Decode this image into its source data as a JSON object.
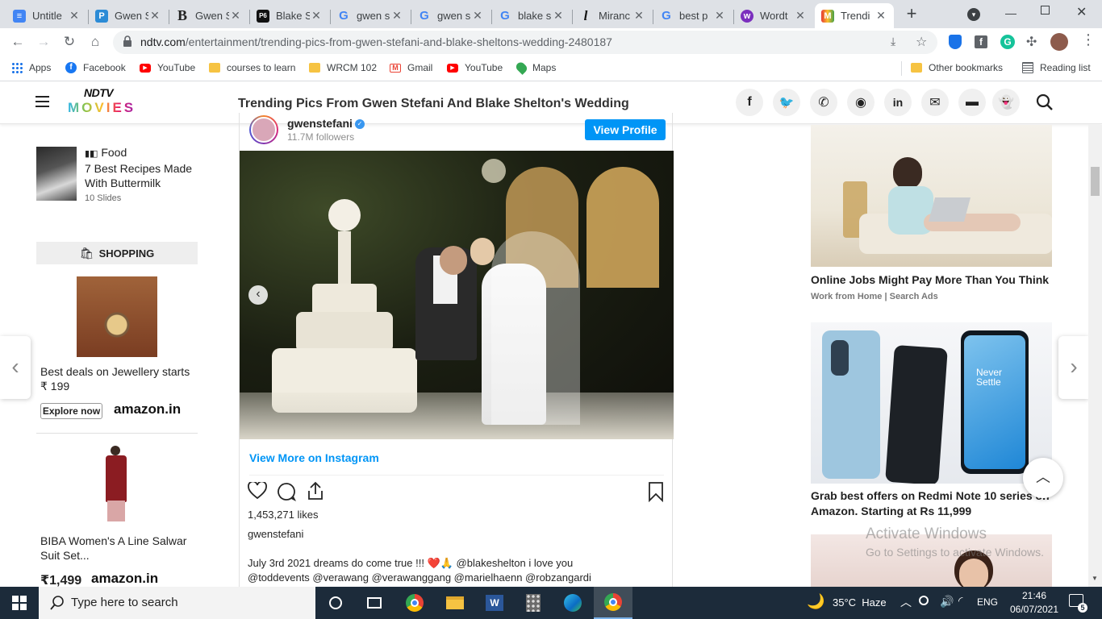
{
  "tabs": [
    {
      "title": "Untitle",
      "icon": "docs-icon",
      "color": "#4285f4",
      "glyph": "≡"
    },
    {
      "title": "Gwen S",
      "icon": "pinkvilla-icon",
      "color": "#2b8bd6",
      "glyph": "P"
    },
    {
      "title": "Gwen S",
      "icon": "b-icon",
      "color": "#ffffff",
      "glyph": "B"
    },
    {
      "title": "Blake S",
      "icon": "pagesix-icon",
      "color": "#111111",
      "glyph": "6"
    },
    {
      "title": "gwen s",
      "icon": "google-icon",
      "color": "#ffffff",
      "glyph": "G"
    },
    {
      "title": "gwen s",
      "icon": "google-icon",
      "color": "#ffffff",
      "glyph": "G"
    },
    {
      "title": "blake s",
      "icon": "google-icon",
      "color": "#ffffff",
      "glyph": "G"
    },
    {
      "title": "Miranc",
      "icon": "l-icon",
      "color": "#ffffff",
      "glyph": "l"
    },
    {
      "title": "best p",
      "icon": "google-icon",
      "color": "#ffffff",
      "glyph": "G"
    },
    {
      "title": "Wordt",
      "icon": "wordtune-icon",
      "color": "#7b2fbe",
      "glyph": "w"
    },
    {
      "title": "Trendi",
      "icon": "ndtv-icon",
      "color": "#ffffff",
      "glyph": "M"
    }
  ],
  "toolbar": {
    "url_domain": "ndtv.com",
    "url_path": "/entertainment/trending-pics-from-gwen-stefani-and-blake-sheltons-wedding-2480187"
  },
  "bookmarks": {
    "items": [
      {
        "label": "Apps",
        "icon": "apps-grid-icon",
        "color": "#1a73e8"
      },
      {
        "label": "Facebook",
        "icon": "facebook-icon",
        "color": "#1877f2"
      },
      {
        "label": "YouTube",
        "icon": "youtube-icon",
        "color": "#ff0000"
      },
      {
        "label": "courses to learn",
        "icon": "folder-icon",
        "color": "#f6c342"
      },
      {
        "label": "WRCM 102",
        "icon": "folder-icon",
        "color": "#f6c342"
      },
      {
        "label": "Gmail",
        "icon": "gmail-icon",
        "color": "#ea4335"
      },
      {
        "label": "YouTube",
        "icon": "youtube-icon",
        "color": "#ff0000"
      },
      {
        "label": "Maps",
        "icon": "maps-icon",
        "color": "#34a853"
      }
    ],
    "other": "Other bookmarks",
    "reading": "Reading list"
  },
  "site": {
    "logo_top": "NDTV",
    "logo_bottom": "MOVIES",
    "headline": "Trending Pics From Gwen Stefani And Blake Shelton's Wedding"
  },
  "left": {
    "food_tag": "Food",
    "food_title": "7 Best Recipes Made With Buttermilk",
    "food_slides": "10 Slides",
    "shopping_label": "SHOPPING",
    "jewel_text": "Best deals on Jewellery starts",
    "jewel_price": "₹ 199",
    "explore": "Explore now",
    "amazon": "amazon.in",
    "biba_title": "BIBA Women's A Line Salwar Suit Set...",
    "biba_price": "₹1,499",
    "amazon2": "amazon.in"
  },
  "post": {
    "username": "gwenstefani",
    "followers": "11.7M followers",
    "view_profile": "View Profile",
    "view_more": "View More on Instagram",
    "likes": "1,453,271 likes",
    "caption_user": "gwenstefani",
    "caption_line1": "July 3rd 2021 dreams do come true !!! ❤️🙏 @blakeshelton i love you",
    "caption_line2": "@toddevents @verawang @verawanggang @marielhaenn @robzangardi"
  },
  "right": {
    "ad1_title": "Online Jobs Might Pay More Than You Think",
    "ad1_source": "Work from Home | Search Ads",
    "ad2_overlay": "Never Settle",
    "ad2_title": "Grab best offers on Redmi Note 10 series on Amazon. Starting at Rs 11,999",
    "watermark1": "Activate Windows",
    "watermark2": "Go to Settings to activate Windows."
  },
  "taskbar": {
    "search_placeholder": "Type here to search",
    "weather": "35°C  Haze",
    "lang": "ENG",
    "time": "21:46",
    "date": "06/07/2021",
    "notif_count": "5"
  }
}
